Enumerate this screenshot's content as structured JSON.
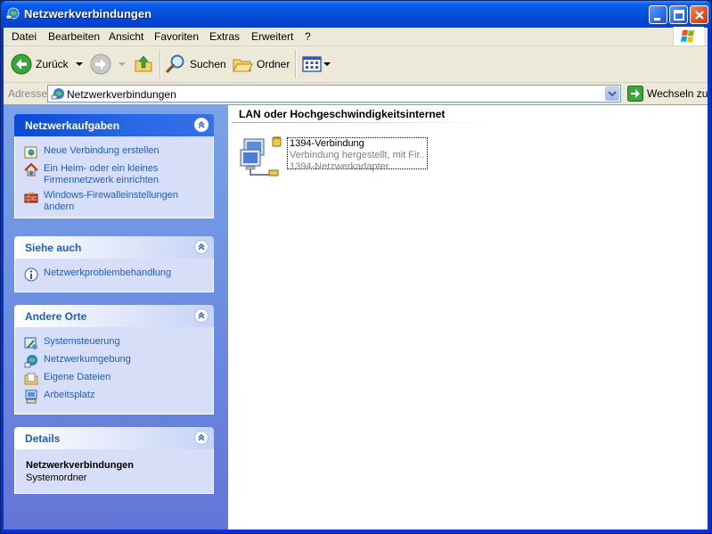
{
  "window": {
    "title": "Netzwerkverbindungen"
  },
  "menu": [
    "Datei",
    "Bearbeiten",
    "Ansicht",
    "Favoriten",
    "Extras",
    "Erweitert",
    "?"
  ],
  "toolbar": {
    "back_label": "Zurück",
    "search_label": "Suchen",
    "folders_label": "Ordner"
  },
  "address": {
    "label": "Adresse",
    "value": "Netzwerkverbindungen",
    "go_label": "Wechseln zu"
  },
  "taskpane": {
    "network_tasks": {
      "title": "Netzwerkaufgaben",
      "items": [
        {
          "label": "Neue Verbindung erstellen",
          "icon": "new-connection-icon"
        },
        {
          "label": "Ein Heim- oder ein kleines Firmennetzwerk einrichten",
          "icon": "home-network-icon"
        },
        {
          "label": "Windows-Firewalleinstellungen ändern",
          "icon": "firewall-icon"
        }
      ]
    },
    "see_also": {
      "title": "Siehe auch",
      "items": [
        {
          "label": "Netzwerkproblembehandlung",
          "icon": "info-icon"
        }
      ]
    },
    "other_places": {
      "title": "Andere Orte",
      "items": [
        {
          "label": "Systemsteuerung",
          "icon": "control-panel-icon"
        },
        {
          "label": "Netzwerkumgebung",
          "icon": "network-places-icon"
        },
        {
          "label": "Eigene Dateien",
          "icon": "my-documents-icon"
        },
        {
          "label": "Arbeitsplatz",
          "icon": "my-computer-icon"
        }
      ]
    },
    "details": {
      "title": "Details",
      "name": "Netzwerkverbindungen",
      "type": "Systemordner"
    }
  },
  "main": {
    "group_title": "LAN oder Hochgeschwindigkeitsinternet",
    "connections": [
      {
        "name": "1394-Verbindung",
        "status": "Verbindung hergestellt, mit Fir...",
        "adapter": "1394-Netzwerkadapter"
      }
    ]
  },
  "colors": {
    "title_bar": "#0553e0",
    "link": "#215dc6",
    "taskpane": "#6b8de0"
  }
}
